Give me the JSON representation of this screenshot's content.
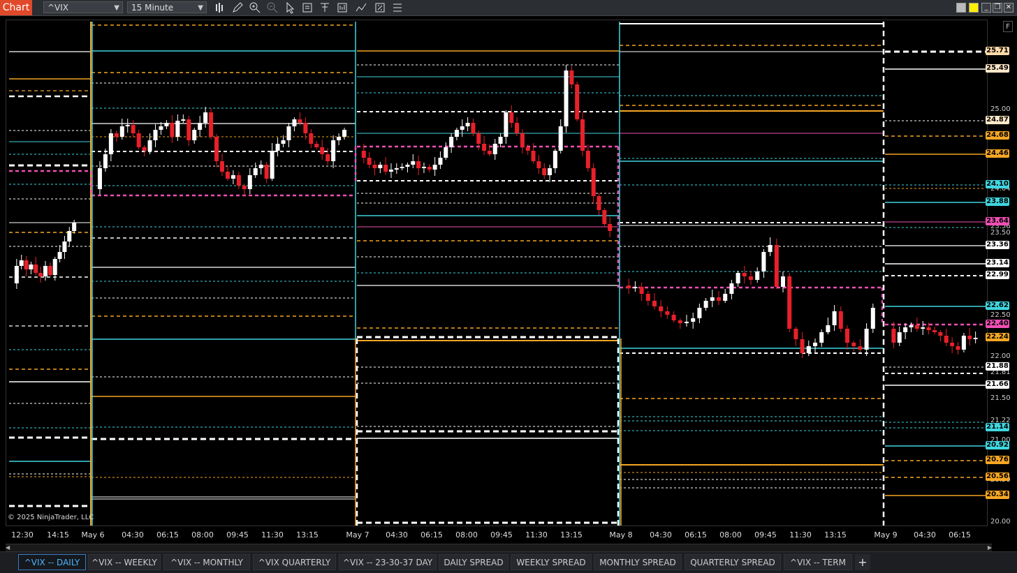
{
  "toolbar": {
    "badge": "Chart",
    "instrument": "^VIX",
    "interval": "15 Minute",
    "icons": [
      "bar-type-icon",
      "pencil-icon",
      "zoom-in-icon",
      "zoom-out-icon",
      "pointer-icon",
      "data-box-icon",
      "properties-icon",
      "templates-icon",
      "indicators-icon",
      "strategies-icon",
      "menu-icon"
    ],
    "window_buttons": [
      "gray",
      "yellow",
      "minimize",
      "restore",
      "close"
    ]
  },
  "copyright": "© 2025 NinjaTrader, LLC",
  "f_button": "F",
  "price_axis": {
    "ticks": [
      "25.00",
      "24.04",
      "23.50",
      "23.56",
      "22.50",
      "22.00",
      "21.81",
      "21.50",
      "21.22",
      "21.00",
      "20.50",
      "20.00"
    ],
    "labels": [
      {
        "text": "25.71",
        "bg": "#ffd8a8",
        "fg": "#000"
      },
      {
        "text": "25.49",
        "bg": "#ffe8c8",
        "fg": "#000"
      },
      {
        "text": "24.87",
        "bg": "#ffe8c8",
        "fg": "#000"
      },
      {
        "text": "24.68",
        "bg": "#f5a623",
        "fg": "#000"
      },
      {
        "text": "24.46",
        "bg": "#f5a623",
        "fg": "#000"
      },
      {
        "text": "24.10",
        "bg": "#3fd6e0",
        "fg": "#000"
      },
      {
        "text": "23.88",
        "bg": "#3fd6e0",
        "fg": "#000"
      },
      {
        "text": "23.64",
        "bg": "#f04fb4",
        "fg": "#000"
      },
      {
        "text": "23.36",
        "bg": "#ffffff",
        "fg": "#000"
      },
      {
        "text": "23.14",
        "bg": "#ffffff",
        "fg": "#000"
      },
      {
        "text": "22.99",
        "bg": "#ffffff",
        "fg": "#000"
      },
      {
        "text": "22.62",
        "bg": "#3fd6e0",
        "fg": "#000"
      },
      {
        "text": "22.40",
        "bg": "#f04fb4",
        "fg": "#000"
      },
      {
        "text": "22.24",
        "bg": "#f5a623",
        "fg": "#000"
      },
      {
        "text": "21.88",
        "bg": "#ffffff",
        "fg": "#000"
      },
      {
        "text": "21.66",
        "bg": "#ffffff",
        "fg": "#000"
      },
      {
        "text": "21.14",
        "bg": "#3fd6e0",
        "fg": "#000"
      },
      {
        "text": "20.92",
        "bg": "#3fd6e0",
        "fg": "#000"
      },
      {
        "text": "20.76",
        "bg": "#f5a623",
        "fg": "#000"
      },
      {
        "text": "20.56",
        "bg": "#f5a623",
        "fg": "#000"
      },
      {
        "text": "20.34",
        "bg": "#f5a623",
        "fg": "#000"
      }
    ]
  },
  "time_axis": [
    "12:30",
    "14:15",
    "May 6",
    "04:30",
    "06:15",
    "08:00",
    "09:45",
    "11:30",
    "13:15",
    "May 7",
    "04:30",
    "06:15",
    "08:00",
    "09:45",
    "11:30",
    "13:15",
    "May 8",
    "04:30",
    "06:15",
    "08:00",
    "09:45",
    "11:30",
    "13:15",
    "May 9",
    "04:30",
    "06:15"
  ],
  "tabs": [
    {
      "label": "^VIX -- DAILY",
      "active": true
    },
    {
      "label": "^VIX -- WEEKLY",
      "active": false
    },
    {
      "label": "^VIX -- MONTHLY",
      "active": false
    },
    {
      "label": "^VIX QUARTERLY",
      "active": false
    },
    {
      "label": "^VIX -- 23-30-37 DAY",
      "active": false
    },
    {
      "label": "DAILY SPREAD",
      "active": false
    },
    {
      "label": "WEEKLY SPREAD",
      "active": false
    },
    {
      "label": "MONTHLY SPREAD",
      "active": false
    },
    {
      "label": "QUARTERLY SPREAD",
      "active": false
    },
    {
      "label": "^VIX -- TERM",
      "active": false
    }
  ],
  "add_tab": "+",
  "chart_data": {
    "type": "candlestick",
    "instrument": "^VIX",
    "interval": "15 Minute",
    "ylim": [
      20.0,
      25.9
    ],
    "colors": {
      "up": "#ffffff",
      "down": "#e8202a",
      "cyan": "#3fd6e0",
      "orange": "#f5a623",
      "magenta": "#f04fb4",
      "white": "#ffffff"
    }
  }
}
